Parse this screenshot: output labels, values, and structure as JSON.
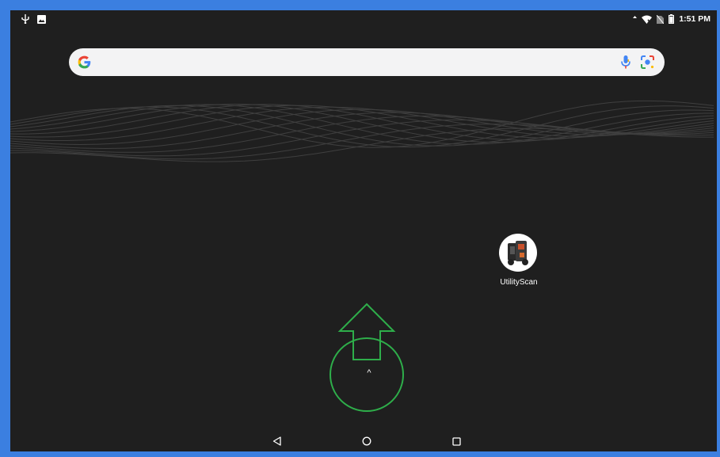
{
  "status_bar": {
    "time": "1:51 PM",
    "left_icons": [
      "usb-icon",
      "image-icon"
    ],
    "right_icons": [
      "data-arrow-icon",
      "wifi-icon",
      "no-sim-icon",
      "battery-icon"
    ]
  },
  "search_bar": {
    "logo": "google-logo",
    "icons": [
      "mic-icon",
      "lens-icon"
    ]
  },
  "apps": [
    {
      "label": "UtilityScan",
      "icon": "utilityscan-app-icon"
    }
  ],
  "annotation": {
    "gesture": "swipe-up",
    "color": "#2eae4a",
    "handle_glyph": "^"
  },
  "nav_bar": {
    "buttons": [
      "back-icon",
      "home-icon",
      "recents-icon"
    ]
  },
  "colors": {
    "wallpaper": "#1f1f1f",
    "frame": "#3b7fe0",
    "search_bar": "#f3f3f4"
  }
}
